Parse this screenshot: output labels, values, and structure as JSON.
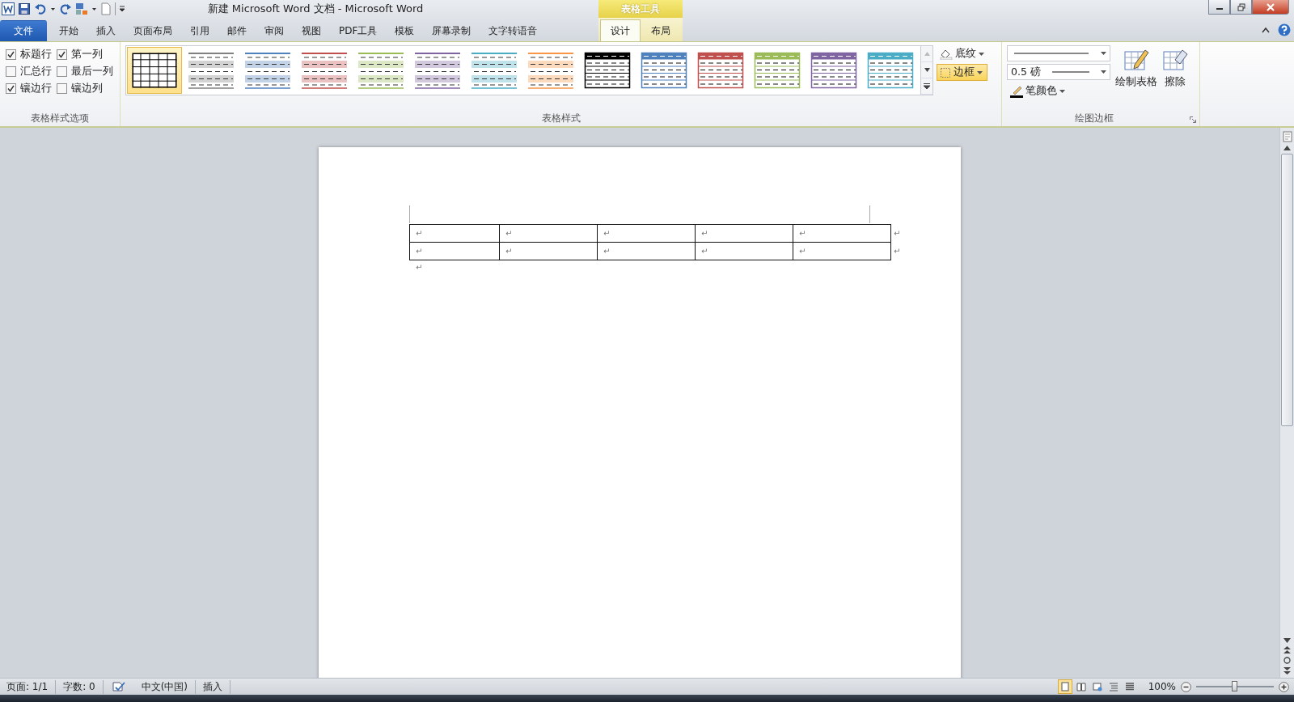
{
  "window": {
    "title": "新建 Microsoft Word 文档 - Microsoft Word",
    "context_tab_header": "表格工具"
  },
  "ribbon_tabs": [
    {
      "label": "文件",
      "kind": "file",
      "selected": false
    },
    {
      "label": "开始",
      "kind": "tab",
      "selected": false
    },
    {
      "label": "插入",
      "kind": "tab",
      "selected": false
    },
    {
      "label": "页面布局",
      "kind": "tab",
      "selected": false
    },
    {
      "label": "引用",
      "kind": "tab",
      "selected": false
    },
    {
      "label": "邮件",
      "kind": "tab",
      "selected": false
    },
    {
      "label": "审阅",
      "kind": "tab",
      "selected": false
    },
    {
      "label": "视图",
      "kind": "tab",
      "selected": false
    },
    {
      "label": "PDF工具",
      "kind": "tab",
      "selected": false
    },
    {
      "label": "模板",
      "kind": "tab",
      "selected": false
    },
    {
      "label": "屏幕录制",
      "kind": "tab",
      "selected": false
    },
    {
      "label": "文字转语音",
      "kind": "tab",
      "selected": false
    },
    {
      "label": "设计",
      "kind": "context",
      "selected": true
    },
    {
      "label": "布局",
      "kind": "context",
      "selected": false
    }
  ],
  "style_options": {
    "title": "表格样式选项",
    "checkboxes": [
      {
        "label": "标题行",
        "checked": true
      },
      {
        "label": "第一列",
        "checked": true
      },
      {
        "label": "汇总行",
        "checked": false
      },
      {
        "label": "最后一列",
        "checked": false
      },
      {
        "label": "镶边行",
        "checked": true
      },
      {
        "label": "镶边列",
        "checked": false
      }
    ]
  },
  "table_styles": {
    "title": "表格样式",
    "gallery": [
      {
        "kind": "grid",
        "color": "#000000",
        "selected": true
      },
      {
        "kind": "banded",
        "color": "#808080",
        "selected": false
      },
      {
        "kind": "banded",
        "color": "#4f81bd",
        "selected": false
      },
      {
        "kind": "banded",
        "color": "#c0504d",
        "selected": false
      },
      {
        "kind": "banded",
        "color": "#9bbb59",
        "selected": false
      },
      {
        "kind": "banded",
        "color": "#8064a2",
        "selected": false
      },
      {
        "kind": "banded",
        "color": "#4bacc6",
        "selected": false
      },
      {
        "kind": "banded",
        "color": "#f79646",
        "selected": false
      },
      {
        "kind": "header",
        "color": "#000000",
        "selected": false
      },
      {
        "kind": "header",
        "color": "#4f81bd",
        "selected": false
      },
      {
        "kind": "header",
        "color": "#c0504d",
        "selected": false
      },
      {
        "kind": "header",
        "color": "#9bbb59",
        "selected": false
      },
      {
        "kind": "header",
        "color": "#8064a2",
        "selected": false
      },
      {
        "kind": "header",
        "color": "#4bacc6",
        "selected": false
      }
    ],
    "shading": {
      "label": "底纹",
      "active": false
    },
    "borders": {
      "label": "边框",
      "active": true
    }
  },
  "draw_borders": {
    "title": "绘图边框",
    "line_weight": "0.5 磅",
    "pen_color": "笔颜色",
    "buttons": [
      "绘制表格",
      "擦除"
    ]
  },
  "document": {
    "table": {
      "rows": [
        {
          "cells": [
            "↵",
            "↵",
            "↵",
            "↵",
            "↵"
          ],
          "end_mark": "↵"
        },
        {
          "cells": [
            "↵",
            "↵",
            "↵",
            "↵",
            "↵"
          ],
          "end_mark": "↵"
        }
      ]
    },
    "paragraph_mark": "↵"
  },
  "status_bar": {
    "items": [
      "页面: 1/1",
      "字数: 0",
      "中文(中国)",
      "插入"
    ],
    "views": [
      {
        "kind": "print",
        "selected": true
      },
      {
        "kind": "reading",
        "selected": false
      },
      {
        "kind": "web",
        "selected": false
      },
      {
        "kind": "outline",
        "selected": false
      },
      {
        "kind": "draft",
        "selected": false
      }
    ],
    "zoom": "100%",
    "zoom_slider": {
      "level": 0.5
    }
  }
}
